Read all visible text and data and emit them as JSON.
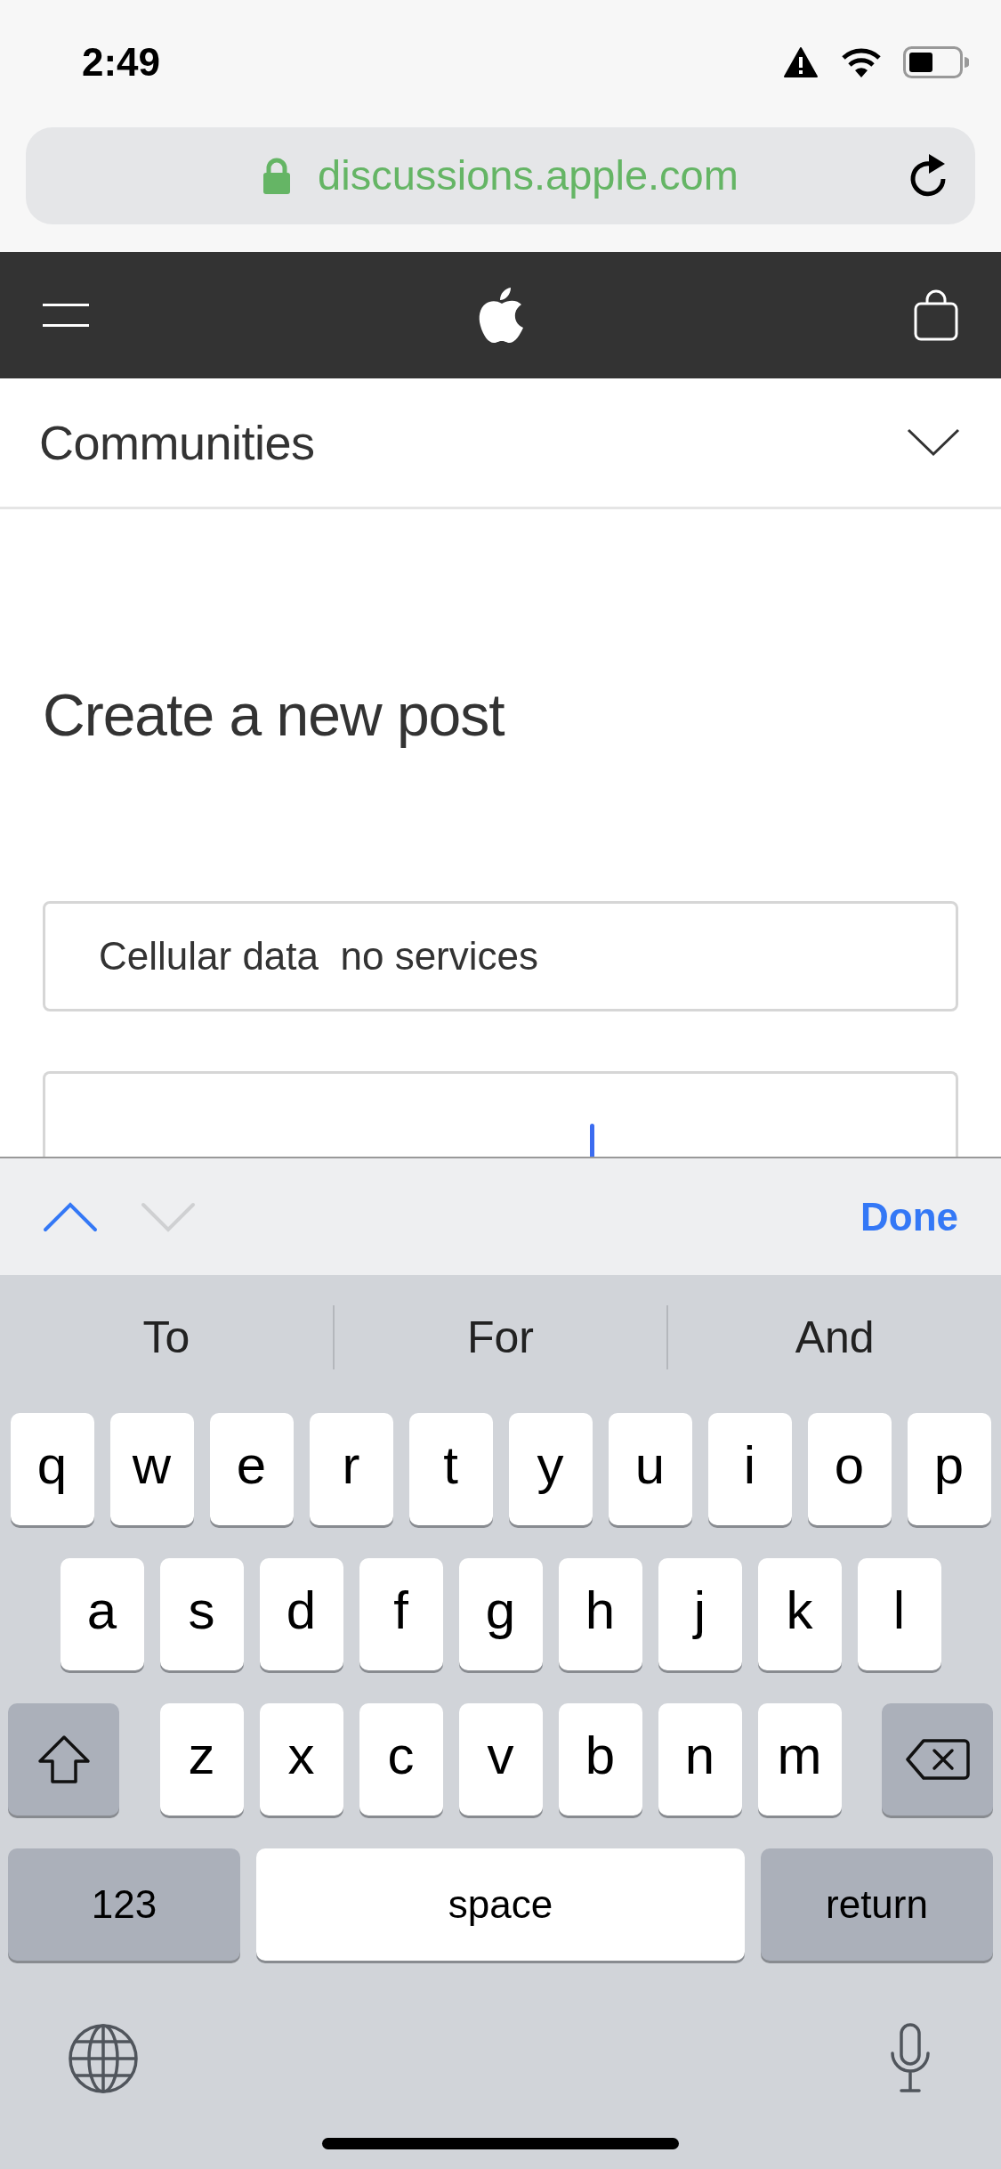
{
  "status_bar": {
    "time": "2:49"
  },
  "address_bar": {
    "url": "discussions.apple.com"
  },
  "section_menu": {
    "label": "Communities",
    "expanded": false
  },
  "page": {
    "title": "Create a new post"
  },
  "form": {
    "subject": {
      "value": "Cellular data  no services"
    }
  },
  "form_nav": {
    "previous": {
      "disabled": false
    },
    "next": {
      "disabled": true
    },
    "done": "Done"
  },
  "keyboard": {
    "suggestions": [
      "To",
      "For",
      "And"
    ],
    "letter_rows": [
      [
        "q",
        "w",
        "e",
        "r",
        "t",
        "y",
        "u",
        "i",
        "o",
        "p"
      ],
      [
        "a",
        "s",
        "d",
        "f",
        "g",
        "h",
        "j",
        "k",
        "l"
      ],
      [
        "z",
        "x",
        "c",
        "v",
        "b",
        "n",
        "m"
      ]
    ],
    "bottom_row": {
      "numbers": "123",
      "space": "space",
      "return": "return"
    }
  }
}
